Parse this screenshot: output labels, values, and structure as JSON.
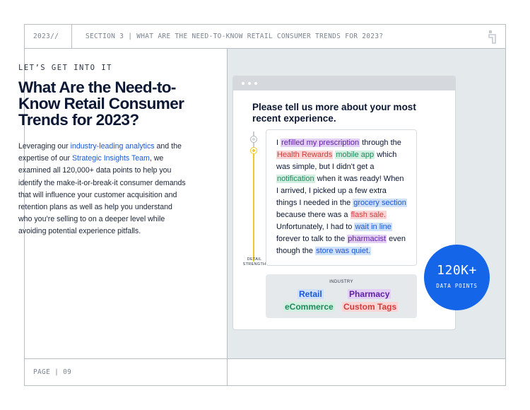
{
  "header": {
    "year": "2023//",
    "section": "SECTION 3 | WHAT ARE THE NEED-TO-KNOW RETAIL CONSUMER TRENDS FOR 2023?"
  },
  "footer": {
    "page": "PAGE | 09"
  },
  "left": {
    "kicker": "LET’S GET INTO IT",
    "title": "What Are the Need-to-Know Retail Consumer Trends for 2023?",
    "body_parts": [
      "Leveraging our ",
      "industry-leading analytics",
      " and the expertise of our ",
      "Strategic Insights Team",
      ", we examined all 120,000+ data points to help you identify the make-it-or-break-it consumer demands that will influence your customer acquisition and retention plans as well as help you understand who you’re selling to on a deeper level while avoiding potential experience pitfalls."
    ]
  },
  "card": {
    "question": "Please tell us more about your most recent experience.",
    "slider_label": "DETAIL STRENGTH",
    "response": [
      {
        "t": "I ",
        "h": ""
      },
      {
        "t": "refilled my prescription",
        "h": "purple"
      },
      {
        "t": " through the ",
        "h": ""
      },
      {
        "t": "Health Rewards",
        "h": "red"
      },
      {
        "t": " ",
        "h": ""
      },
      {
        "t": "mobile app",
        "h": "green"
      },
      {
        "t": " which was simple, but I didn't get a ",
        "h": ""
      },
      {
        "t": "notification",
        "h": "green"
      },
      {
        "t": " when it was ready! When I arrived, I picked up a few extra things I needed in the ",
        "h": ""
      },
      {
        "t": "grocery section",
        "h": "blue"
      },
      {
        "t": " because there was a ",
        "h": ""
      },
      {
        "t": "flash sale.",
        "h": "red"
      },
      {
        "t": " Unfortunately, I had to ",
        "h": ""
      },
      {
        "t": "wait in line",
        "h": "blue"
      },
      {
        "t": " forever to talk to the ",
        "h": ""
      },
      {
        "t": "pharmacist",
        "h": "purple"
      },
      {
        "t": " even though the ",
        "h": ""
      },
      {
        "t": "store was quiet.",
        "h": "blue"
      }
    ],
    "industry": {
      "heading": "INDUSTRY",
      "tags": [
        "Retail",
        "Pharmacy",
        "eCommerce",
        "Custom Tags"
      ]
    }
  },
  "badge": {
    "value": "120K+",
    "label": "DATA POINTS"
  },
  "colors": {
    "accent_blue": "#1565e8",
    "link_blue": "#1a57d6",
    "panel_bg": "#e4e9eb",
    "slider_yellow": "#f0c929"
  }
}
